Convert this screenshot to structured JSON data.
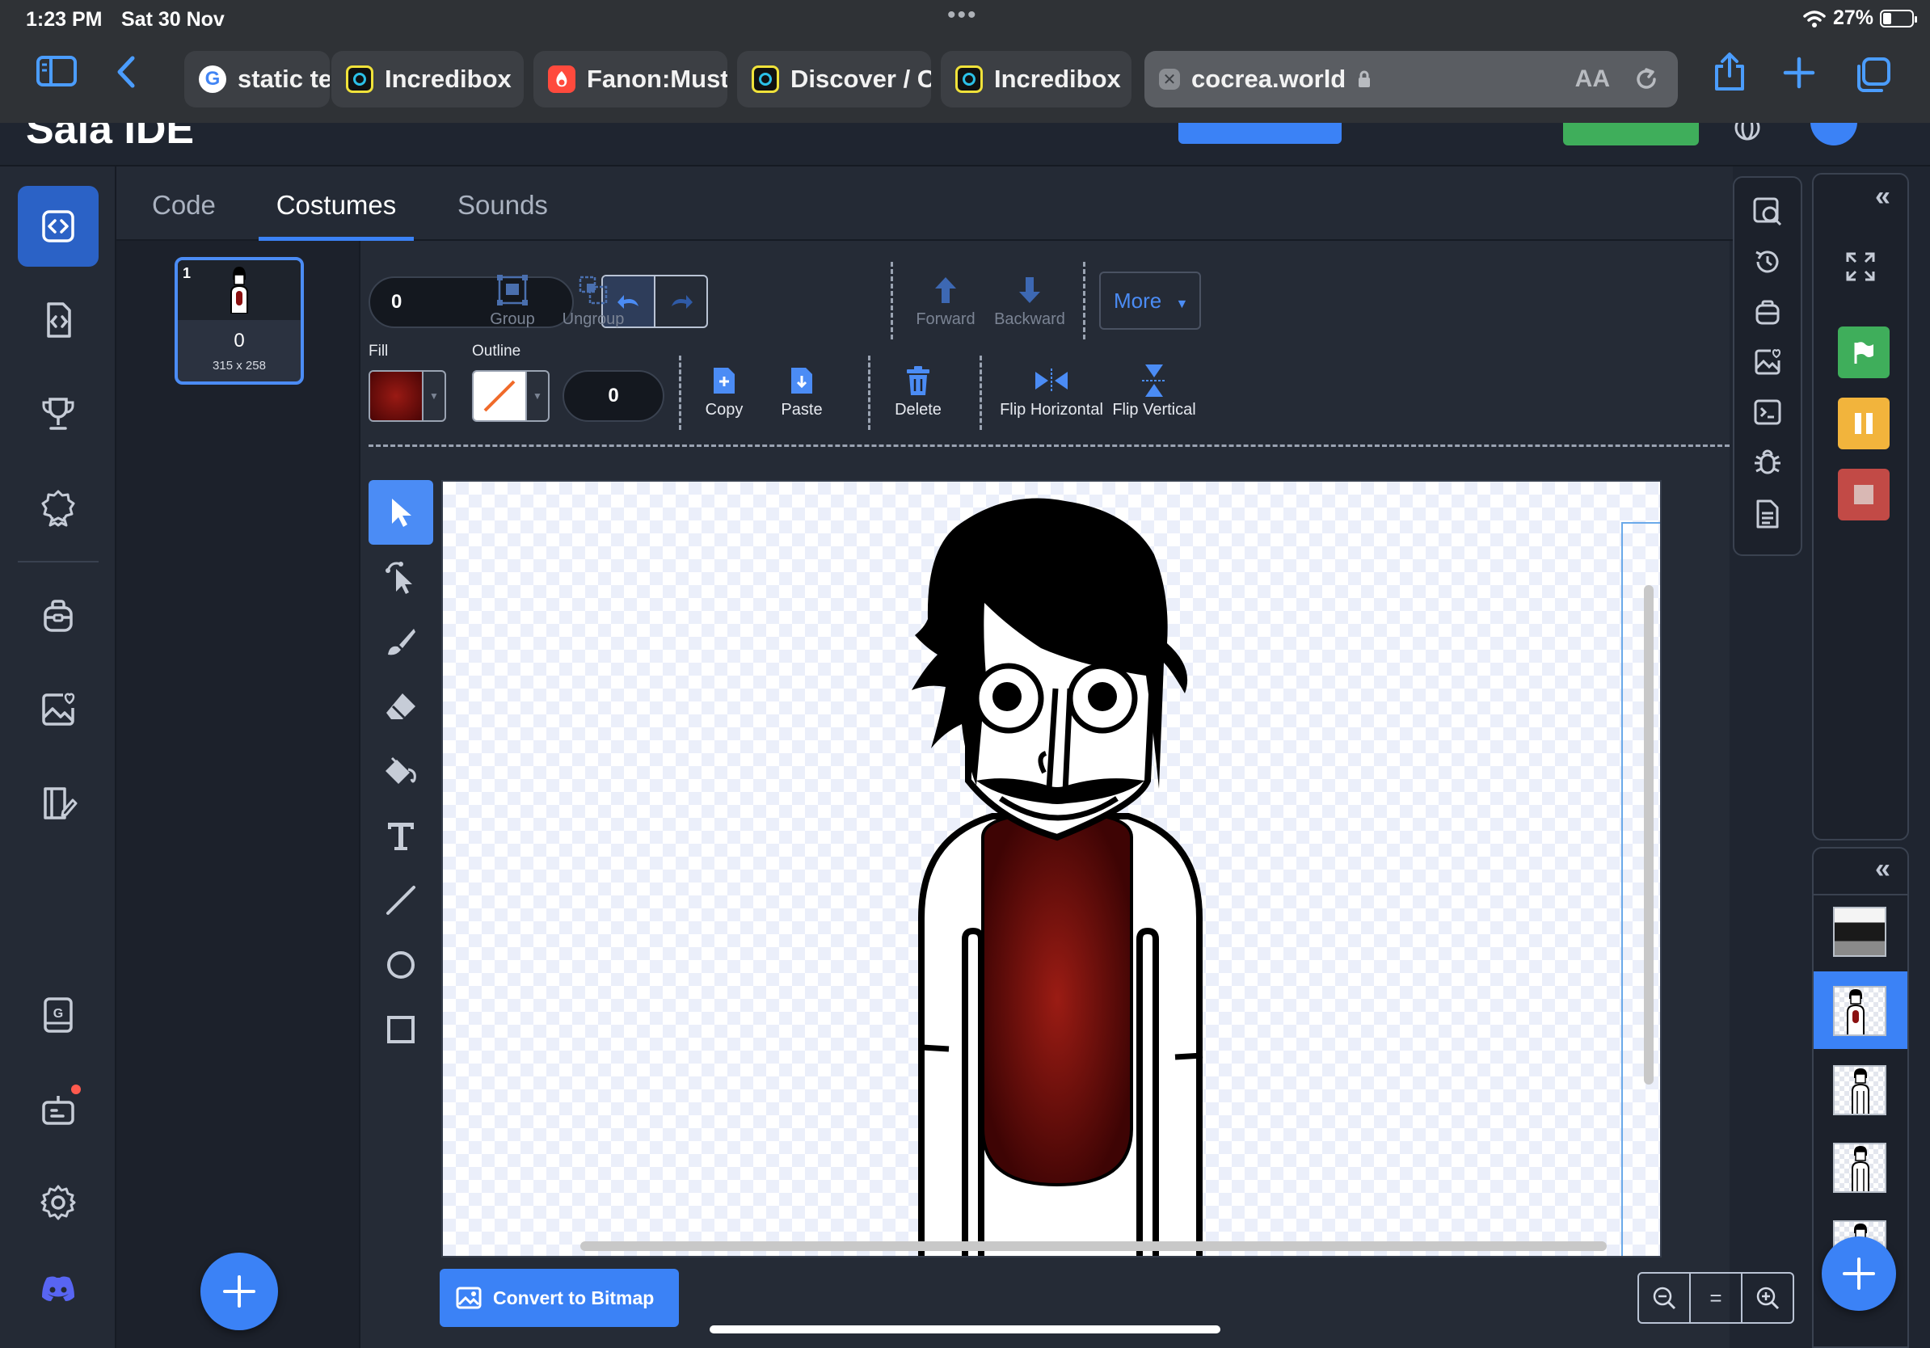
{
  "status_bar": {
    "time": "1:23 PM",
    "date": "Sat 30 Nov",
    "battery": "27%"
  },
  "browser": {
    "tabs": [
      {
        "title": "static te",
        "favicon": "google-icon"
      },
      {
        "title": "Incredibox",
        "favicon": "incredibox-icon"
      },
      {
        "title": "Fanon:Must",
        "favicon": "fandom-icon"
      },
      {
        "title": "Discover / C",
        "favicon": "incredibox-icon"
      },
      {
        "title": "Incredibox",
        "favicon": "incredibox-icon"
      }
    ],
    "active_tab": {
      "title": "cocrea.world",
      "reader_label": "AA"
    }
  },
  "app": {
    "logo_text": "Sala IDE"
  },
  "editor_tabs": [
    "Code",
    "Costumes",
    "Sounds"
  ],
  "active_editor_tab": "Costumes",
  "costume": {
    "index": "1",
    "name": "0",
    "size": "315 x 258"
  },
  "toolbar": {
    "name_value": "0",
    "group": "Group",
    "ungroup": "Ungroup",
    "forward": "Forward",
    "backward": "Backward",
    "more": "More",
    "fill_label": "Fill",
    "outline_label": "Outline",
    "outline_width": "0",
    "copy": "Copy",
    "paste": "Paste",
    "delete": "Delete",
    "flip_h": "Flip Horizontal",
    "flip_v": "Flip Vertical"
  },
  "colors": {
    "fill": "#7a0d0d",
    "accent": "#3b82f6",
    "green_flag": "#3fae5b",
    "pause": "#f2b43c",
    "stop": "#c24a46"
  },
  "convert_button": "Convert to Bitmap",
  "zoom": {
    "reset": "="
  }
}
